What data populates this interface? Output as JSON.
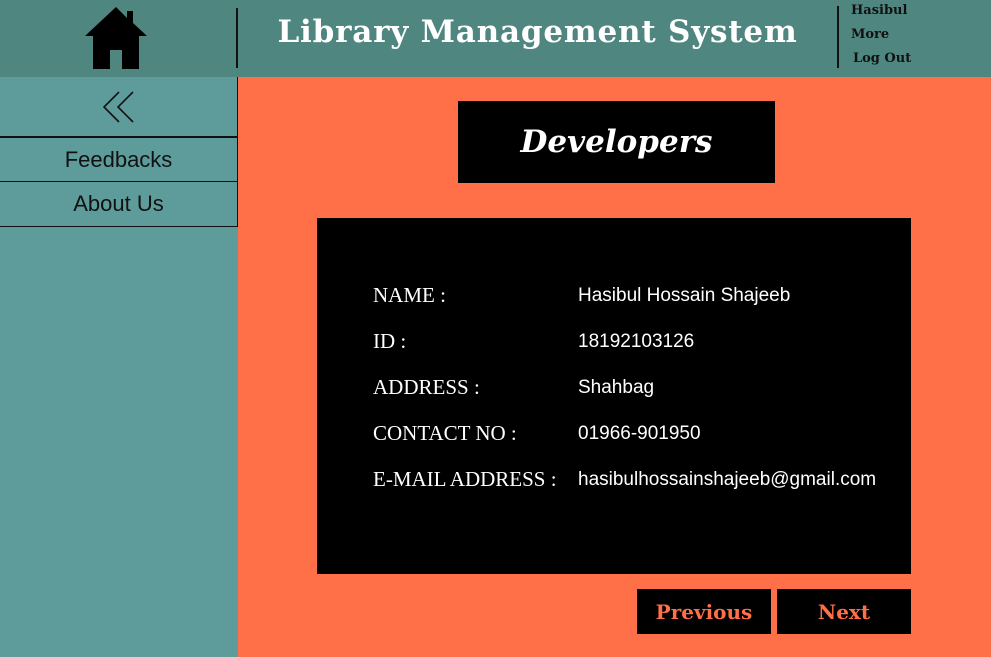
{
  "header": {
    "home_icon": "home-icon",
    "title": "Library Management System",
    "user_name": "Hasibul",
    "more_label": "More",
    "logout_label": "Log Out"
  },
  "sidebar": {
    "collapse_icon": "double-chevron-left-icon",
    "items": [
      {
        "label": "Feedbacks"
      },
      {
        "label": "About Us"
      }
    ]
  },
  "main": {
    "section_title": "Developers",
    "developer": {
      "rows": [
        {
          "label": "NAME :",
          "value": "Hasibul Hossain Shajeeb"
        },
        {
          "label": "ID :",
          "value": "18192103126"
        },
        {
          "label": "ADDRESS :",
          "value": "Shahbag"
        },
        {
          "label": "CONTACT NO :",
          "value": "01966-901950"
        },
        {
          "label": "E-MAIL ADDRESS :",
          "value": "hasibulhossainshajeeb@gmail.com"
        }
      ]
    },
    "previous_label": "Previous",
    "next_label": "Next"
  },
  "colors": {
    "header_bg": "#4f8680",
    "sidebar_bg": "#5e9c9c",
    "main_bg": "#ff6f48",
    "panel_bg": "#000000",
    "button_text": "#ff6f48"
  }
}
